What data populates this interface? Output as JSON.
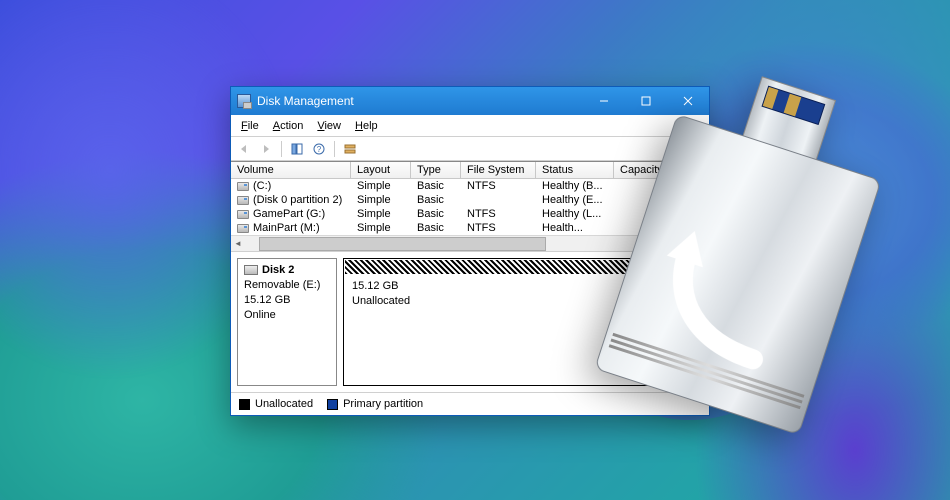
{
  "window": {
    "title": "Disk Management",
    "menu": {
      "file": "File",
      "action": "Action",
      "view": "View",
      "help": "Help"
    },
    "controls": {
      "minimize": "Minimize",
      "maximize": "Maximize",
      "close": "Close"
    }
  },
  "volumes": {
    "headers": {
      "volume": "Volume",
      "layout": "Layout",
      "type": "Type",
      "filesystem": "File System",
      "status": "Status",
      "capacity": "Capacity"
    },
    "rows": [
      {
        "name": "(C:)",
        "layout": "Simple",
        "type": "Basic",
        "fs": "NTFS",
        "status": "Healthy (B..."
      },
      {
        "name": "(Disk 0 partition 2)",
        "layout": "Simple",
        "type": "Basic",
        "fs": "",
        "status": "Healthy (E..."
      },
      {
        "name": "GamePart (G:)",
        "layout": "Simple",
        "type": "Basic",
        "fs": "NTFS",
        "status": "Healthy (L..."
      },
      {
        "name": "MainPart (M:)",
        "layout": "Simple",
        "type": "Basic",
        "fs": "NTFS",
        "status": "Health..."
      }
    ]
  },
  "disk": {
    "title": "Disk 2",
    "line1": "Removable (E:)",
    "line2": "15.12 GB",
    "line3": "Online",
    "partition_size": "15.12 GB",
    "partition_state": "Unallocated"
  },
  "legend": {
    "unallocated": "Unallocated",
    "primary": "Primary partition"
  }
}
